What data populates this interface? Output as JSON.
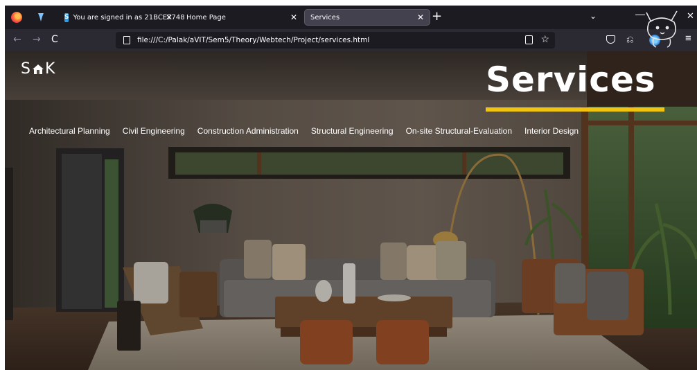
{
  "browser": {
    "tabs": [
      {
        "label": "You are signed in as 21BCE7748",
        "close": "✕",
        "favicon": "S"
      },
      {
        "label": "Home Page",
        "close": "✕"
      },
      {
        "label": "Services",
        "close": "✕"
      }
    ],
    "new_tab": "+",
    "url": "file:///C:/Palak/aVIT/Sem5/Theory/Webtech/Project/services.html",
    "icons": {
      "back": "←",
      "forward": "→",
      "reload": "C",
      "star": "☆",
      "extensions": "⎌",
      "menu": "≡",
      "tab_list": "⌄",
      "minimize": "—",
      "close": "✕"
    }
  },
  "site": {
    "logo_left": "S",
    "logo_right": "K",
    "page_title": "Services",
    "services": [
      "Architectural Planning",
      "Civil Engineering",
      "Construction Administration",
      "Structural Engineering",
      "On-site Structural-Evaluation",
      "Interior Design"
    ]
  },
  "colors": {
    "accent_underline": "#f1c40f",
    "browser_chrome": "#1c1b22",
    "active_tab": "#42414d"
  }
}
